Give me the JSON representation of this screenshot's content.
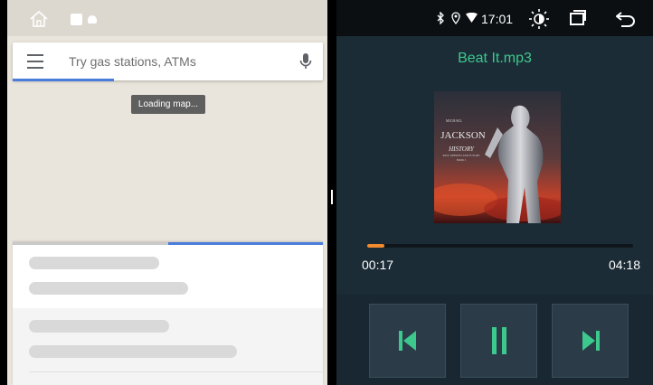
{
  "maps": {
    "search_placeholder": "Try gas stations, ATMs",
    "loading_text": "Loading map..."
  },
  "status_bar": {
    "time": "17:01",
    "icons": [
      "bluetooth-icon",
      "location-icon",
      "wifi-icon"
    ]
  },
  "player": {
    "track_title": "Beat It.mp3",
    "album_art": {
      "artist_small": "MICHAEL",
      "artist": "JACKSON",
      "album": "HISTORY",
      "subtitle": "PAST, PRESENT AND FUTURE",
      "book": "BOOK I"
    },
    "current_time": "00:17",
    "total_time": "04:18",
    "progress": 0.066
  },
  "colors": {
    "accent_green": "#3dc88d",
    "progress_orange": "#f28b30",
    "maps_blue": "#4a7ddb"
  }
}
